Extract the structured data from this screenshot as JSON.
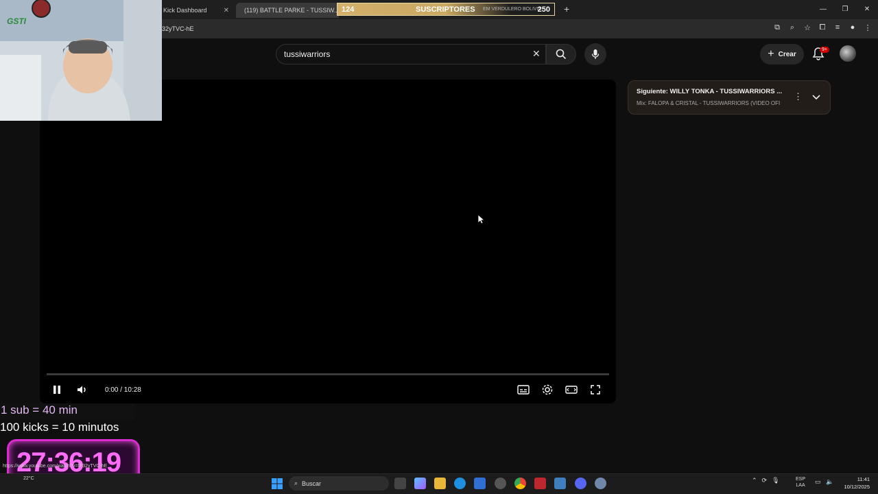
{
  "browser": {
    "tabs": [
      {
        "title": "Kick Dashboard"
      },
      {
        "title": "(119) BATTLE PARKE - TUSSIW..."
      }
    ],
    "new_tab_icon": "plus-icon",
    "url_fragment": "32yTVC-hE"
  },
  "sub_goal": {
    "current": "124",
    "label": "SUSCRIPTORES",
    "behind_text": "EM VERDULERO BOLIVIA",
    "goal": "250"
  },
  "header": {
    "search_value": "tussiwarriors",
    "create_label": "Crear",
    "notification_badge": "9+"
  },
  "player": {
    "time": "0:00 / 10:28",
    "progress_fraction": 0.0
  },
  "up_next": {
    "title": "Siguiente: WILLY TONKA - TUSSIWARRIORS ...",
    "subtitle": "Mix: FALOPA & CRISTAL - TUSSIWARRIORS (VIDEO OFI"
  },
  "webcam": {
    "tag": "GSTI"
  },
  "stream_overlay": {
    "line1": "1 sub = 40 min",
    "line2": "100 kicks = 10 minutos",
    "timer": "27:36:19",
    "hover_url": "https://www.youtube.com/watch?v=fP32yTVC-hE"
  },
  "taskbar": {
    "search_label": "Buscar",
    "weather": "22°C",
    "lang_top": "ESP",
    "lang_bottom": "LAA",
    "time": "11:41",
    "date": "10/12/2025"
  },
  "colors": {
    "yt_red": "#ff0000",
    "timer_pink": "#ff6cf7",
    "card_bg": "#221d19"
  }
}
